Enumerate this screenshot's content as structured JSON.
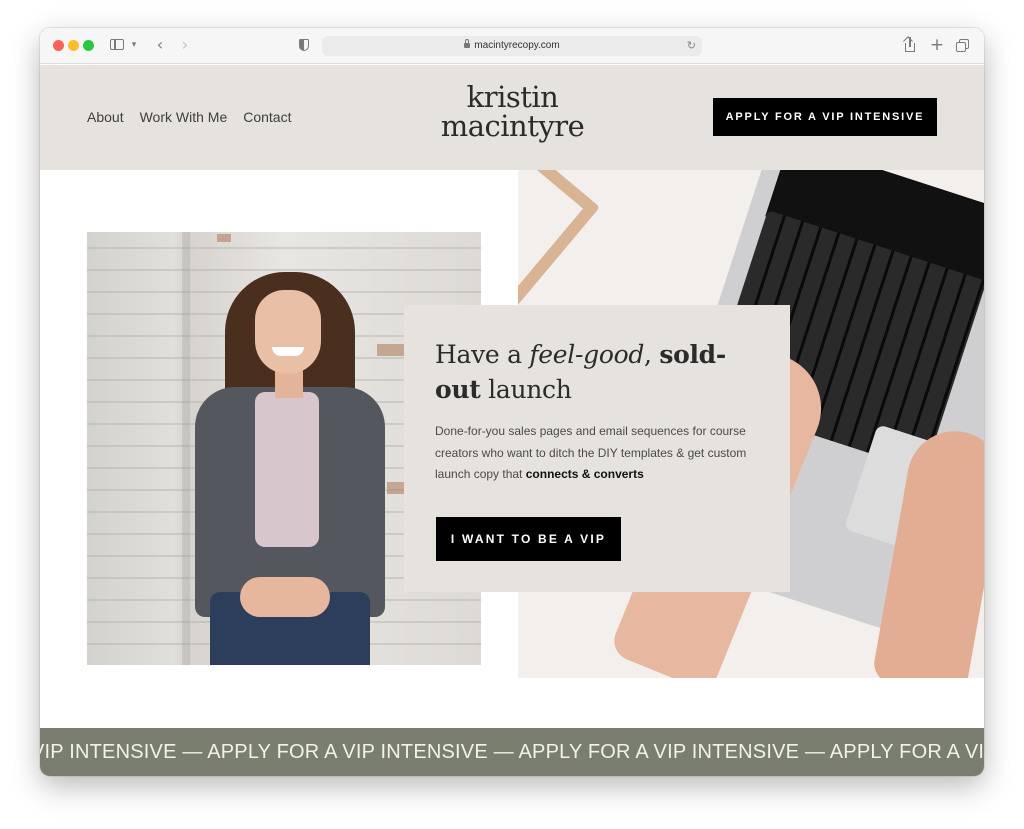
{
  "browser": {
    "url": "macintyrecopy.com",
    "icons": {
      "sidebar": "sidebar-icon",
      "back": "chevron-left-icon",
      "forward": "chevron-right-icon",
      "privacy": "shield-icon",
      "lock": "lock-icon",
      "reload": "reload-icon",
      "share": "share-icon",
      "new_tab": "plus-icon",
      "tab_overview": "tabs-icon"
    }
  },
  "site": {
    "nav": [
      "About",
      "Work With Me",
      "Contact"
    ],
    "logo": {
      "line1": "kristin",
      "line2": "macintyre"
    },
    "header_cta": "APPLY FOR A VIP INTENSIVE"
  },
  "hero": {
    "headline": {
      "part1": "Have a ",
      "italic": "feel-good",
      "part2": ", ",
      "bold1": "sold-out",
      "part3": " launch"
    },
    "body": {
      "text": "Done-for-you sales pages and email sequences for course creators who want to ditch the DIY templates & get custom launch copy that ",
      "bold": "connects & converts"
    },
    "cta": "I WANT TO BE A VIP"
  },
  "ticker": {
    "text": "VIP INTENSIVE — APPLY FOR A VIP INTENSIVE — APPLY FOR A VIP INTENSIVE — APPLY FOR A VIP INTENSIVE"
  },
  "colors": {
    "header_bg": "#e6e2de",
    "card_bg": "#e6e2de",
    "button_bg": "#000000",
    "ticker_bg": "#797e6f",
    "text_dark": "#2b2b2b"
  }
}
